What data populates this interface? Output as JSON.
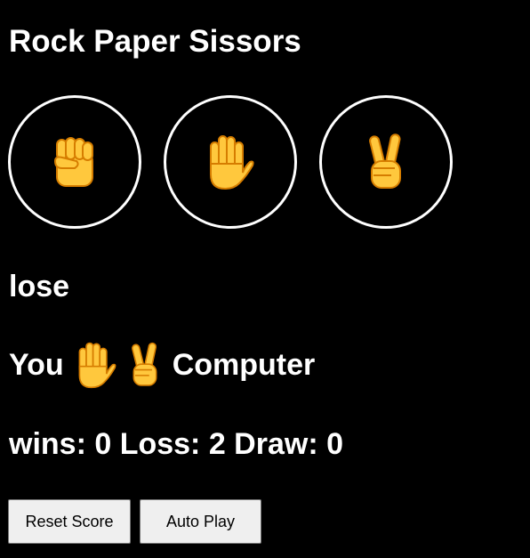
{
  "title": "Rock Paper Sissors",
  "choices": [
    {
      "name": "rock",
      "icon": "raised-fist-icon",
      "glyph": "✊"
    },
    {
      "name": "paper",
      "icon": "raised-hand-icon",
      "glyph": "🖐"
    },
    {
      "name": "scissors",
      "icon": "victory-hand-icon",
      "glyph": "✌"
    }
  ],
  "result": "lose",
  "moves": {
    "player_label": "You",
    "player_icon": "raised-hand-icon",
    "computer_icon": "victory-hand-icon",
    "computer_label": "Computer"
  },
  "score": {
    "text": "wins: 0 Loss: 2 Draw: 0",
    "wins": 0,
    "losses": 2,
    "draws": 0
  },
  "buttons": {
    "reset_label": "Reset Score",
    "auto_play_label": "Auto Play"
  },
  "colors": {
    "background": "#000000",
    "text": "#ffffff",
    "emoji_skin": "#FFC83D",
    "emoji_outline": "#D67D00",
    "button_bg": "#efefef"
  }
}
